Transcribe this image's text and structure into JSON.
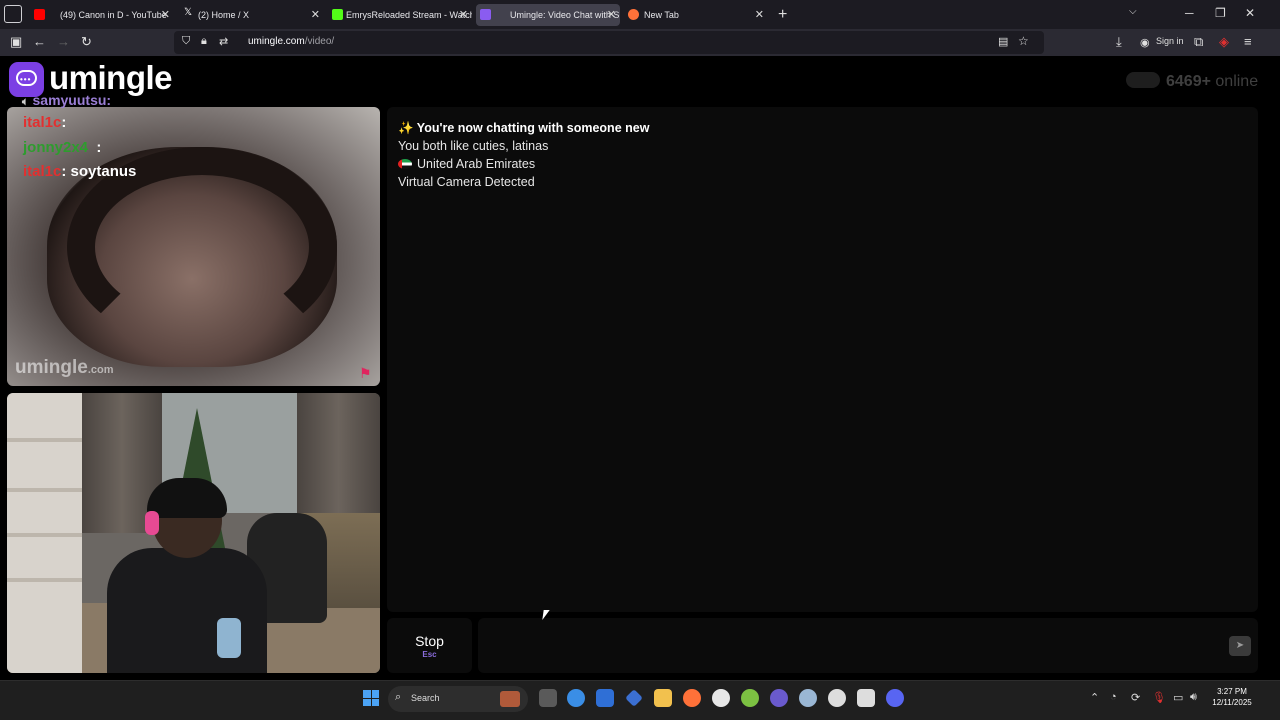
{
  "browser": {
    "tabs": [
      {
        "title": "(49) Canon in D - YouTube",
        "favicon_color": "#ff0000",
        "active": false
      },
      {
        "title": "(2) Home / X",
        "favicon_color": "#ffffff",
        "active": false
      },
      {
        "title": "EmrysReloaded Stream - Watch",
        "favicon_color": "#53fc18",
        "active": false
      },
      {
        "title": "Umingle: Video Chat with S",
        "favicon_color": "#8a5cf0",
        "active": true
      },
      {
        "title": "New Tab",
        "favicon_color": "#ff7139",
        "active": false
      }
    ],
    "url": "umingle.com",
    "url_path": "/video/",
    "sign_in": "Sign in",
    "close_glyph": "✕",
    "new_tab_glyph": "+"
  },
  "site": {
    "logo_text": "umingle",
    "online_count": "6469+",
    "online_label": "online",
    "watermark": "umingle",
    "watermark_suffix": ".com"
  },
  "stranger_overlay": {
    "name": "samyuutsu",
    "lines": [
      {
        "user": "ital1c",
        "message": ""
      },
      {
        "user": "jonny2x4",
        "message": ""
      },
      {
        "user": "ital1c",
        "message": "soytanus"
      }
    ]
  },
  "chat": {
    "messages": [
      {
        "text": "✨ You're now chatting with someone new",
        "bold": true
      },
      {
        "text": "You both like cuties, latinas",
        "bold": false
      },
      {
        "text": "United Arab Emirates",
        "bold": false,
        "flag": "AE"
      },
      {
        "text": "Virtual Camera Detected",
        "bold": false
      }
    ],
    "stop_label": "Stop",
    "stop_key": "Esc",
    "message_placeholder": "",
    "send_glyph": "➤"
  },
  "taskbar": {
    "search_label": "Search",
    "time": "3:27 PM",
    "date": "12/11/2025",
    "apps": [
      {
        "name": "task-view",
        "color": "#5a5a5a"
      },
      {
        "name": "copilot",
        "color": "#3a8ee6"
      },
      {
        "name": "store",
        "color": "#2f6fd6"
      },
      {
        "name": "vpn",
        "color": "#3b6fd1"
      },
      {
        "name": "file-explorer",
        "color": "#f2c14e"
      },
      {
        "name": "firefox",
        "color": "#ff7139"
      },
      {
        "name": "itunes",
        "color": "#e7e7e7"
      },
      {
        "name": "utorrent",
        "color": "#7cc142"
      },
      {
        "name": "obs-alt",
        "color": "#6a5acd"
      },
      {
        "name": "steam",
        "color": "#9ab7d4"
      },
      {
        "name": "obs",
        "color": "#dddddd"
      },
      {
        "name": "capcut",
        "color": "#dddddd"
      },
      {
        "name": "discord",
        "color": "#5865f2"
      }
    ]
  }
}
